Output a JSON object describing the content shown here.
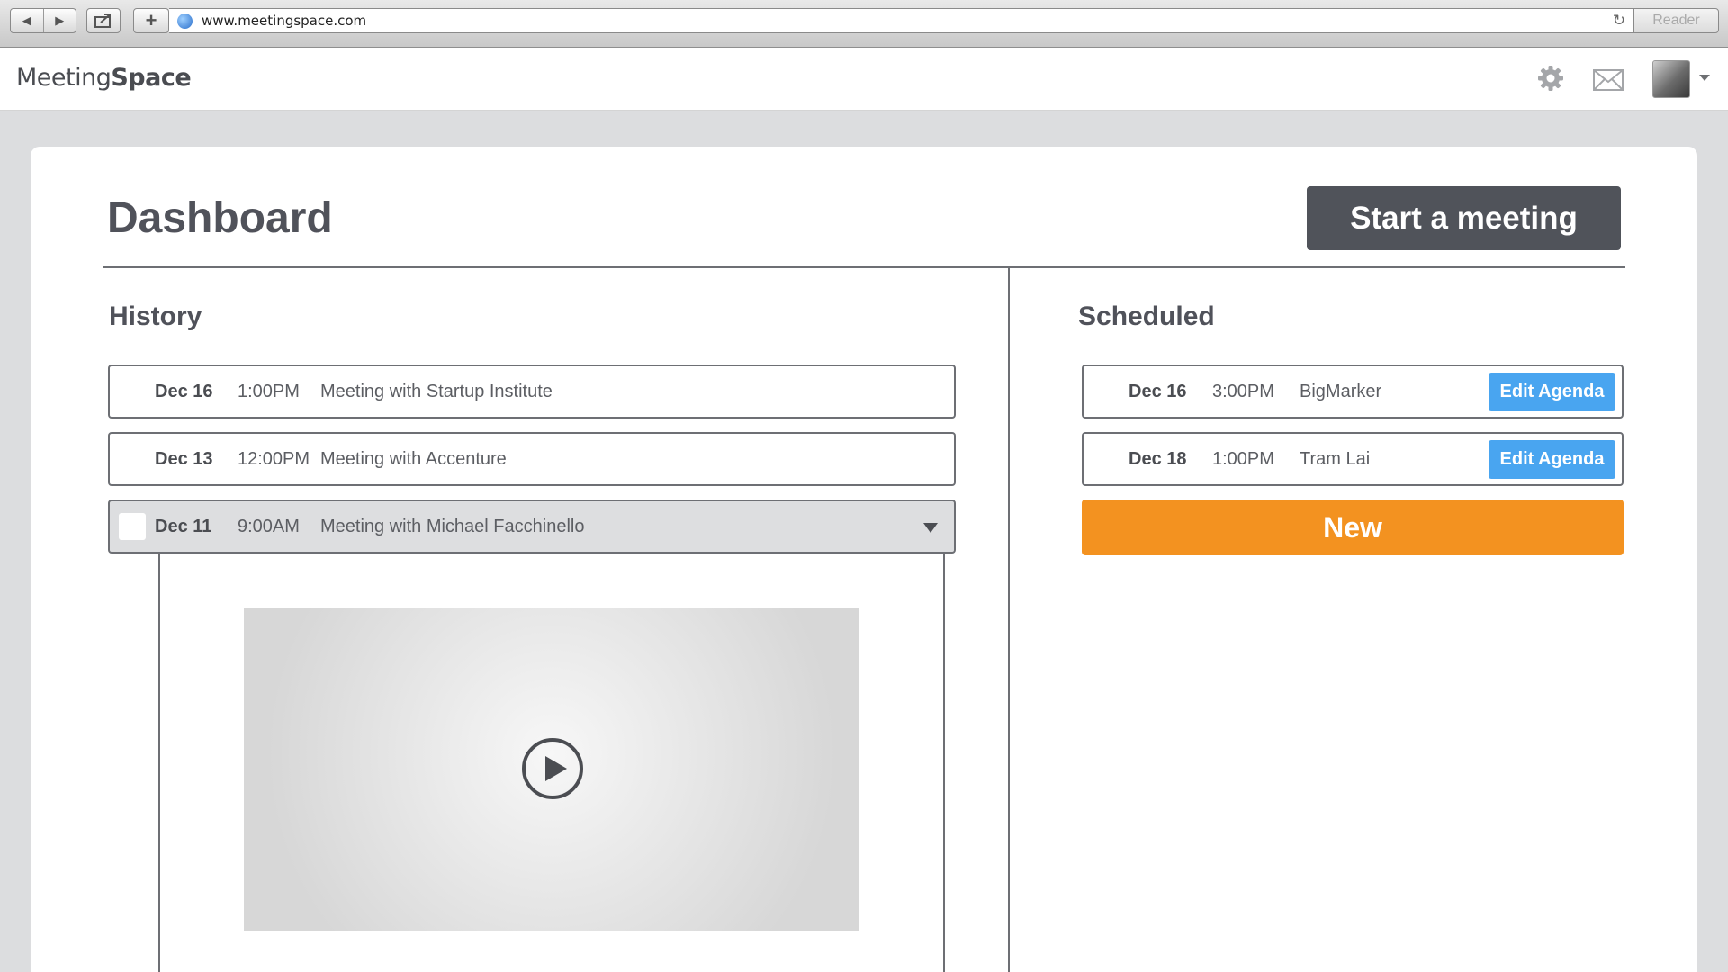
{
  "browser": {
    "url": "www.meetingspace.com",
    "reader_label": "Reader"
  },
  "header": {
    "logo_light": "Meeting",
    "logo_bold": "Space"
  },
  "dashboard": {
    "title": "Dashboard",
    "start_label": "Start a meeting"
  },
  "history": {
    "title": "History",
    "items": [
      {
        "date": "Dec 16",
        "time": "1:00PM",
        "title": "Meeting with Startup Institute"
      },
      {
        "date": "Dec 13",
        "time": "12:00PM",
        "title": "Meeting with Accenture"
      },
      {
        "date": "Dec 11",
        "time": "9:00AM",
        "title": "Meeting with Michael Facchinello"
      }
    ]
  },
  "scheduled": {
    "title": "Scheduled",
    "edit_label": "Edit Agenda",
    "items": [
      {
        "date": "Dec 16",
        "time": "3:00PM",
        "title": "BigMarker"
      },
      {
        "date": "Dec 18",
        "time": "1:00PM",
        "title": "Tram Lai"
      }
    ],
    "new_label": "New"
  },
  "colors": {
    "primary_dark": "#50535a",
    "accent_blue": "#49a5f0",
    "accent_orange": "#f39220"
  }
}
